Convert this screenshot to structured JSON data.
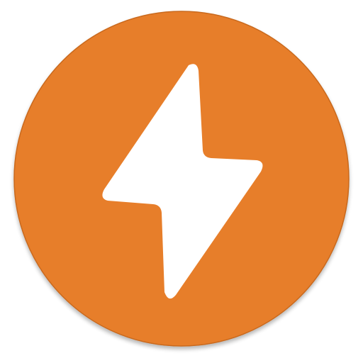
{
  "icon": {
    "name": "lightning-bolt-icon",
    "badge_shape": "circle",
    "colors": {
      "badge": "#E77E2C",
      "badge_shadow": "#C9691F",
      "bolt": "#FFFFFF",
      "background": "#FFFFFF"
    }
  }
}
